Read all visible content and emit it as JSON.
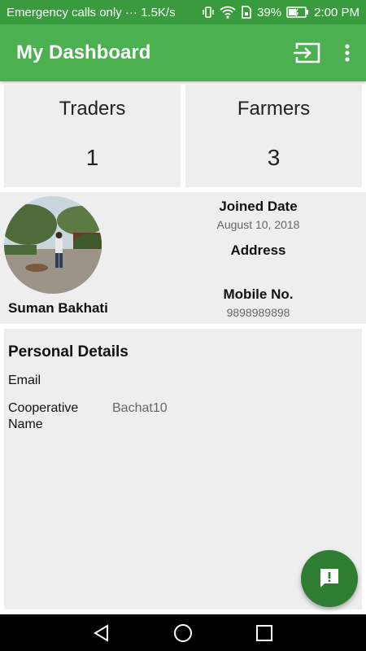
{
  "status_bar": {
    "carrier": "Emergency calls only",
    "dots": "···",
    "speed": "1.5K/s",
    "battery_percent": "39%",
    "time": "2:00 PM",
    "icons": [
      "vibrate-icon",
      "wifi-icon",
      "sim-icon",
      "battery-icon"
    ]
  },
  "app_bar": {
    "title": "My Dashboard",
    "actions": [
      "login-icon",
      "more-vert-icon"
    ]
  },
  "stats": {
    "traders_label": "Traders",
    "traders_value": "1",
    "farmers_label": "Farmers",
    "farmers_value": "3"
  },
  "profile": {
    "name": "Suman Bakhati",
    "joined_label": "Joined Date",
    "joined_value": "August 10, 2018",
    "address_label": "Address",
    "address_value": "",
    "mobile_label": "Mobile No.",
    "mobile_value": "9898989898"
  },
  "personal_details": {
    "title": "Personal Details",
    "email_label": "Email",
    "email_value": "",
    "coop_label": "Cooperative Name",
    "coop_value": "Bachat10"
  },
  "colors": {
    "status_bar": "#3a9b3e",
    "app_bar": "#4caf50",
    "fab": "#2e7d32",
    "card": "#eeeeee"
  }
}
